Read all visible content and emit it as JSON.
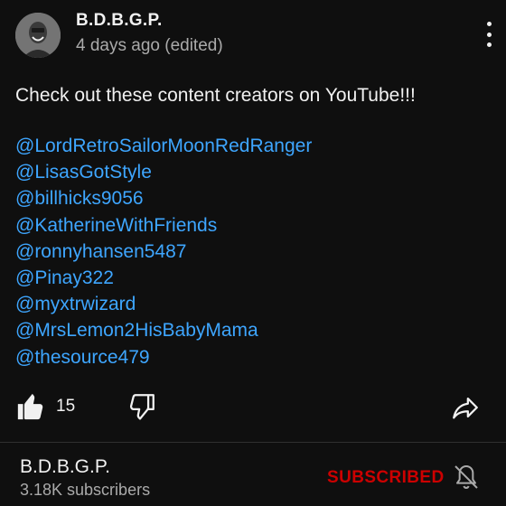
{
  "comment": {
    "author": "B.D.B.G.P.",
    "timestamp": "4 days ago (edited)",
    "text": "Check out these content creators on YouTube!!!",
    "mentions": [
      "@LordRetroSailorMoonRedRanger",
      "@LisasGotStyle",
      "@billhicks9056",
      "@KatherineWithFriends",
      "@ronnyhansen5487",
      "@Pinay322",
      "@myxtrwizard",
      "@MrsLemon2HisBabyMama",
      "@thesource479"
    ],
    "like_count": "15"
  },
  "channel": {
    "name": "B.D.B.G.P.",
    "subscribers": "3.18K subscribers",
    "subscribe_label": "SUBSCRIBED"
  },
  "icons": {
    "menu": "more-vert-icon",
    "like": "thumbs-up-filled-icon",
    "dislike": "thumbs-down-outline-icon",
    "share": "share-arrow-icon",
    "notifications": "bell-off-icon"
  },
  "colors": {
    "background": "#0f0f0f",
    "text": "#f1f1f1",
    "secondary_text": "#aaaaaa",
    "link": "#3ea6ff",
    "subscribed": "#cc0000"
  }
}
